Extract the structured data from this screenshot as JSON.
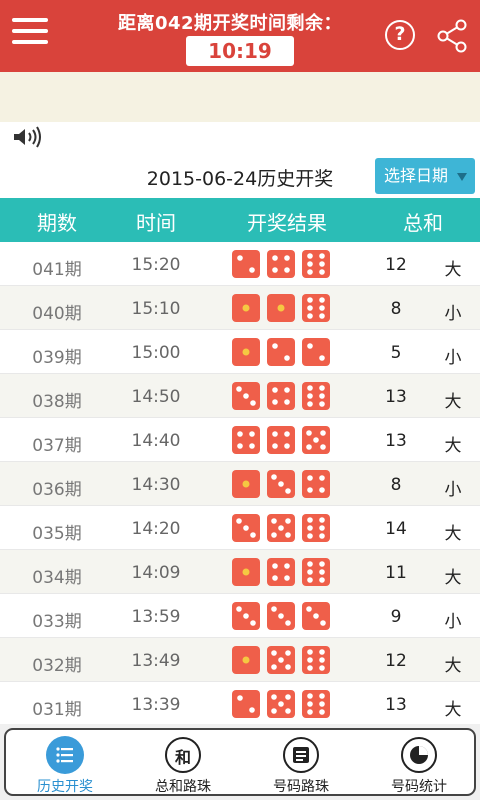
{
  "header": {
    "countdown_label": "距离042期开奖时间剩余：",
    "countdown_time": "10:19",
    "help_glyph": "?",
    "menu_icon": "hamburger-icon",
    "share_icon": "share-icon"
  },
  "sound_icon": "speaker-icon",
  "date_bar": {
    "title": "2015-06-24历史开奖",
    "select_label": "选择日期"
  },
  "table": {
    "headers": [
      "期数",
      "时间",
      "开奖结果",
      "总和"
    ],
    "rows": [
      {
        "issue": "041期",
        "time": "15:20",
        "dice": [
          2,
          4,
          6
        ],
        "sum": "12",
        "size": "大"
      },
      {
        "issue": "040期",
        "time": "15:10",
        "dice": [
          1,
          1,
          6
        ],
        "sum": "8",
        "size": "小"
      },
      {
        "issue": "039期",
        "time": "15:00",
        "dice": [
          1,
          2,
          2
        ],
        "sum": "5",
        "size": "小"
      },
      {
        "issue": "038期",
        "time": "14:50",
        "dice": [
          3,
          4,
          6
        ],
        "sum": "13",
        "size": "大"
      },
      {
        "issue": "037期",
        "time": "14:40",
        "dice": [
          4,
          4,
          5
        ],
        "sum": "13",
        "size": "大"
      },
      {
        "issue": "036期",
        "time": "14:30",
        "dice": [
          1,
          3,
          4
        ],
        "sum": "8",
        "size": "小"
      },
      {
        "issue": "035期",
        "time": "14:20",
        "dice": [
          3,
          5,
          6
        ],
        "sum": "14",
        "size": "大"
      },
      {
        "issue": "034期",
        "time": "14:09",
        "dice": [
          1,
          4,
          6
        ],
        "sum": "11",
        "size": "大"
      },
      {
        "issue": "033期",
        "time": "13:59",
        "dice": [
          3,
          3,
          3
        ],
        "sum": "9",
        "size": "小"
      },
      {
        "issue": "032期",
        "time": "13:49",
        "dice": [
          1,
          5,
          6
        ],
        "sum": "12",
        "size": "大"
      },
      {
        "issue": "031期",
        "time": "13:39",
        "dice": [
          2,
          5,
          6
        ],
        "sum": "13",
        "size": "大"
      }
    ]
  },
  "nav": [
    {
      "label": "历史开奖",
      "icon": "list-icon",
      "glyph": "",
      "active": true
    },
    {
      "label": "总和路珠",
      "icon": "sum-icon",
      "glyph": "和",
      "active": false
    },
    {
      "label": "号码路珠",
      "icon": "card-icon",
      "glyph": "",
      "active": false
    },
    {
      "label": "号码统计",
      "icon": "pie-chart-icon",
      "glyph": "",
      "active": false
    }
  ],
  "colors": {
    "header_red": "#d9433b",
    "teal": "#2bbdb6",
    "date_button_blue": "#3eb5d6",
    "die_red": "#ef5f4a",
    "die_pip": "#ffd66b",
    "nav_active_blue": "#3a9bd9"
  }
}
